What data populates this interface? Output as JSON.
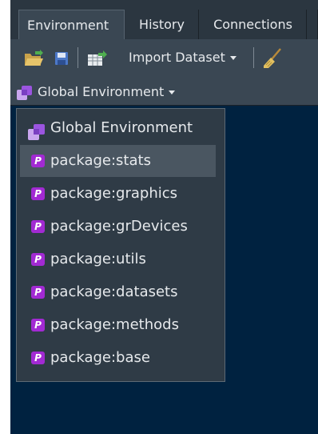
{
  "tabs": [
    {
      "label": "Environment",
      "active": true
    },
    {
      "label": "History",
      "active": false
    },
    {
      "label": "Connections",
      "active": false
    }
  ],
  "toolbar": {
    "import_dataset_label": "Import Dataset",
    "icons": [
      "open-folder-icon",
      "save-icon",
      "import-dataset-icon",
      "broom-icon"
    ]
  },
  "env_selector": {
    "label": "Global Environment"
  },
  "env_menu": {
    "header": "Global Environment",
    "items": [
      {
        "label": "package:stats",
        "hovered": true
      },
      {
        "label": "package:graphics",
        "hovered": false
      },
      {
        "label": "package:grDevices",
        "hovered": false
      },
      {
        "label": "package:utils",
        "hovered": false
      },
      {
        "label": "package:datasets",
        "hovered": false
      },
      {
        "label": "package:methods",
        "hovered": false
      },
      {
        "label": "package:base",
        "hovered": false
      }
    ],
    "package_icon_glyph": "P"
  },
  "colors": {
    "pane_bg": "#2b3640",
    "toolbar_bg": "#3a4753",
    "content_bg": "#002240",
    "package_badge": "#a22ad3"
  }
}
